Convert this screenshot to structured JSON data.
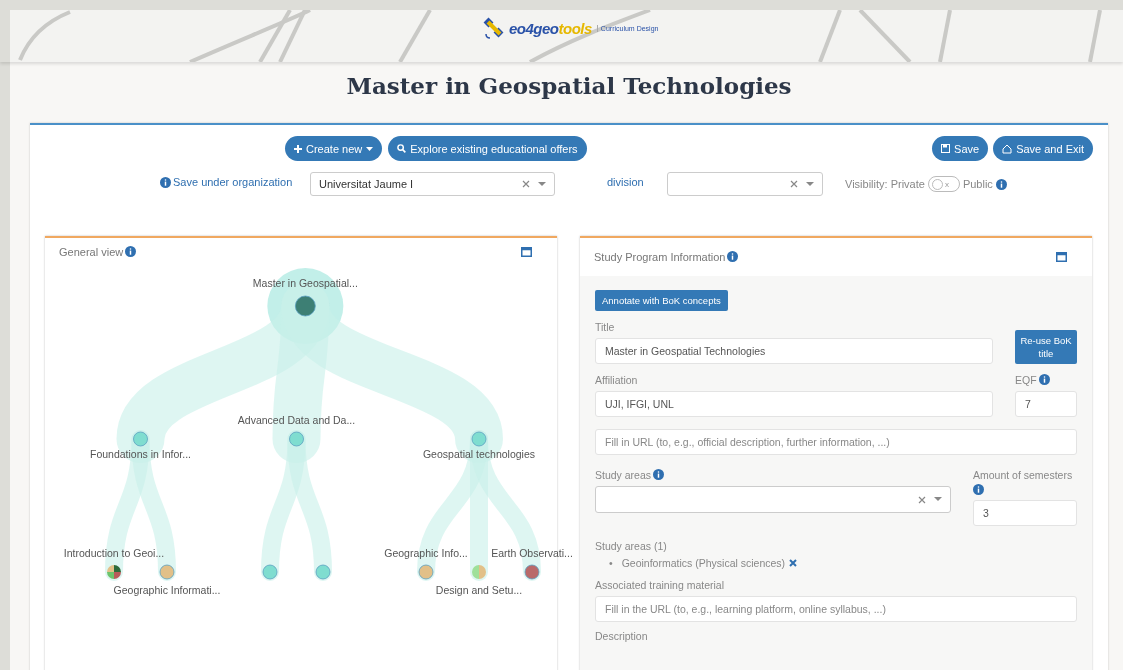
{
  "header": {
    "logo": {
      "brand_a": "eo4geo",
      "brand_b": "tools",
      "tagline": "Curriculum Design"
    }
  },
  "page_title": "Master in Geospatial Technologies",
  "toolbar": {
    "create_button": "Create new",
    "explore_button": "Explore existing educational offers",
    "save_button": "Save",
    "save_exit_button": "Save and Exit"
  },
  "organization": {
    "label": "Save under organization",
    "value": "Universitat Jaume I"
  },
  "division": {
    "label": "division"
  },
  "visibility": {
    "label": "Visibility: Private",
    "on": false,
    "toggle_text": "x",
    "public_label": "Public"
  },
  "general_view": {
    "title": "General view",
    "tree": {
      "label": "Master in Geospatial...",
      "kind": "dot",
      "color": "#3d7f74",
      "children": [
        {
          "label": "Foundations in Infor...",
          "kind": "dot",
          "color": "#7fddd0",
          "children": [
            {
              "label": "Introduction to Geoi...",
              "kind": "pie",
              "slices": [
                {
                  "color": "#2e6b3a"
                },
                {
                  "color": "#b95a5a"
                },
                {
                  "color": "#6cc46c"
                },
                {
                  "color": "#e2c088"
                }
              ]
            },
            {
              "label": "Geographic Informati...",
              "kind": "dot",
              "color": "#e2c088"
            }
          ]
        },
        {
          "label": "Advanced Data and Da...",
          "kind": "dot",
          "color": "#7fddd0",
          "children": [
            {
              "kind": "dot",
              "color": "#7fddd0"
            },
            {
              "kind": "dot",
              "color": "#7fddd0"
            }
          ]
        },
        {
          "label": "Geospatial technologies",
          "kind": "dot",
          "color": "#7fddd0",
          "children": [
            {
              "label": "Geographic Info...",
              "kind": "dot",
              "color": "#e2c088"
            },
            {
              "label": "Design and Setu...",
              "kind": "pie",
              "slices": [
                {
                  "color": "#e2c088"
                },
                {
                  "color": "#9fe09a"
                }
              ]
            },
            {
              "label": "Earth Observati...",
              "kind": "dot",
              "color": "#b96a6a"
            }
          ]
        }
      ]
    }
  },
  "study_program": {
    "title": "Study Program Information",
    "annotate_button": "Annotate with BoK concepts",
    "title_label": "Title",
    "title_value": "Master in Geospatial Technologies",
    "reuse_button": "Re-use BoK title",
    "affiliation_label": "Affiliation",
    "affiliation_value": "UJI, IFGI, UNL",
    "eqf_label": "EQF",
    "eqf_value": "7",
    "url_placeholder": "Fill in URL (to, e.g., official description, further information, ...)",
    "study_areas_label": "Study areas",
    "semesters_label": "Amount of semesters",
    "semesters_value": "3",
    "study_areas_list_label": "Study areas (1)",
    "study_areas": [
      {
        "bullet": "•",
        "name": "Geoinformatics (Physical sciences)"
      }
    ],
    "training_label": "Associated training material",
    "training_placeholder": "Fill in the URL (to, e.g., learning platform, online syllabus, ...)",
    "description_label": "Description"
  }
}
